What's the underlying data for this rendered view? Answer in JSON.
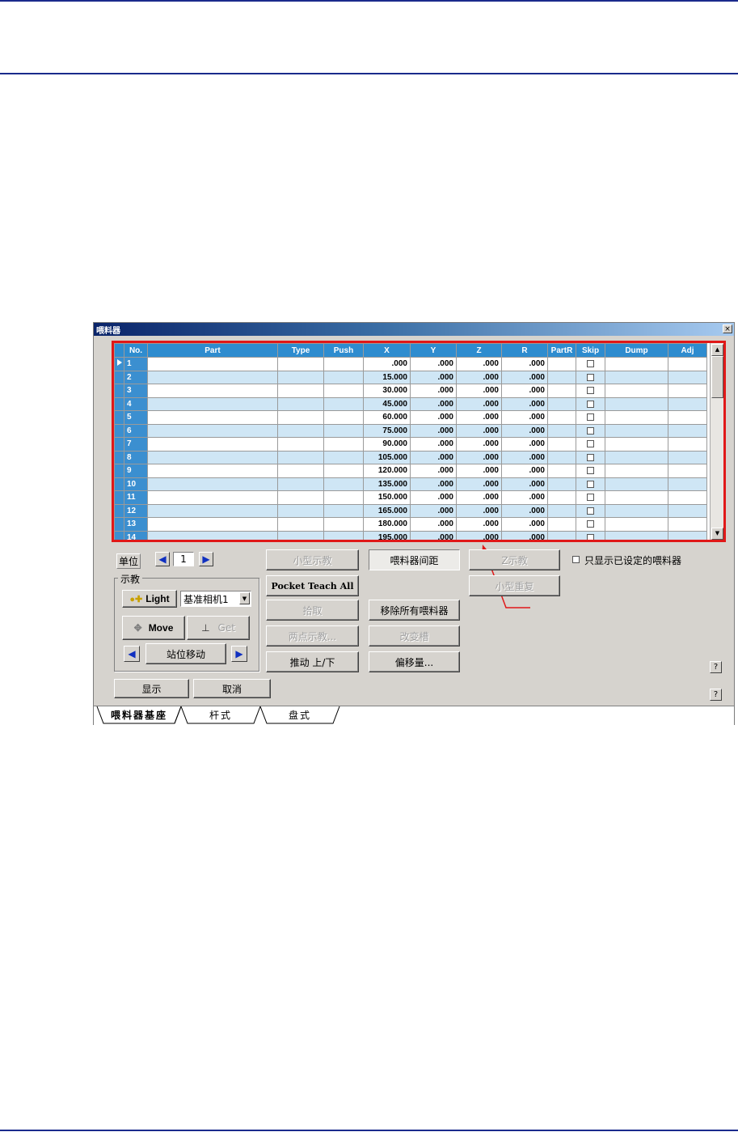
{
  "window": {
    "title": "喂料器",
    "close_glyph": "×"
  },
  "grid": {
    "columns": [
      "No.",
      "Part",
      "Type",
      "Push",
      "X",
      "Y",
      "Z",
      "R",
      "PartR",
      "Skip",
      "Dump",
      "Adj"
    ],
    "rows": [
      {
        "no": "1",
        "x": ".000",
        "y": ".000",
        "z": ".000",
        "r": ".000"
      },
      {
        "no": "2",
        "x": "15.000",
        "y": ".000",
        "z": ".000",
        "r": ".000"
      },
      {
        "no": "3",
        "x": "30.000",
        "y": ".000",
        "z": ".000",
        "r": ".000"
      },
      {
        "no": "4",
        "x": "45.000",
        "y": ".000",
        "z": ".000",
        "r": ".000"
      },
      {
        "no": "5",
        "x": "60.000",
        "y": ".000",
        "z": ".000",
        "r": ".000"
      },
      {
        "no": "6",
        "x": "75.000",
        "y": ".000",
        "z": ".000",
        "r": ".000"
      },
      {
        "no": "7",
        "x": "90.000",
        "y": ".000",
        "z": ".000",
        "r": ".000"
      },
      {
        "no": "8",
        "x": "105.000",
        "y": ".000",
        "z": ".000",
        "r": ".000"
      },
      {
        "no": "9",
        "x": "120.000",
        "y": ".000",
        "z": ".000",
        "r": ".000"
      },
      {
        "no": "10",
        "x": "135.000",
        "y": ".000",
        "z": ".000",
        "r": ".000"
      },
      {
        "no": "11",
        "x": "150.000",
        "y": ".000",
        "z": ".000",
        "r": ".000"
      },
      {
        "no": "12",
        "x": "165.000",
        "y": ".000",
        "z": ".000",
        "r": ".000"
      },
      {
        "no": "13",
        "x": "180.000",
        "y": ".000",
        "z": ".000",
        "r": ".000"
      },
      {
        "no": "14",
        "x": "195.000",
        "y": ".000",
        "z": ".000",
        "r": ".000"
      }
    ]
  },
  "unit": {
    "label": "单位",
    "value": "1"
  },
  "teach_group": {
    "title": "示教",
    "light_label": "Light",
    "camera_value": "基准相机1",
    "move_label": "Move",
    "get_label": "Get",
    "station_move_label": "站位移动"
  },
  "buttons": {
    "small_teach": "小型示教",
    "feeder_pitch": "喂料器间距",
    "z_teach": "Z示教",
    "pocket_teach_all": "Pocket Teach All",
    "small_repeat": "小型重复",
    "pick": "拾取",
    "remove_all_feeders": "移除所有喂料器",
    "two_point_teach": "两点示教...",
    "change_slot": "改变槽",
    "push_up_down": "推动 上/下",
    "offset": "偏移量...",
    "show": "显示",
    "cancel": "取消"
  },
  "only_show_configured": {
    "label": "只显示已设定的喂料器",
    "checked": false
  },
  "tabs": [
    "喂料器基座",
    "杆式",
    "盘式"
  ],
  "help_glyph": "?",
  "colors": {
    "annotation": "#e01818",
    "header": "#2e8ccf",
    "row_alt": "#cfe6f5",
    "title_bar": "#0a246a"
  }
}
